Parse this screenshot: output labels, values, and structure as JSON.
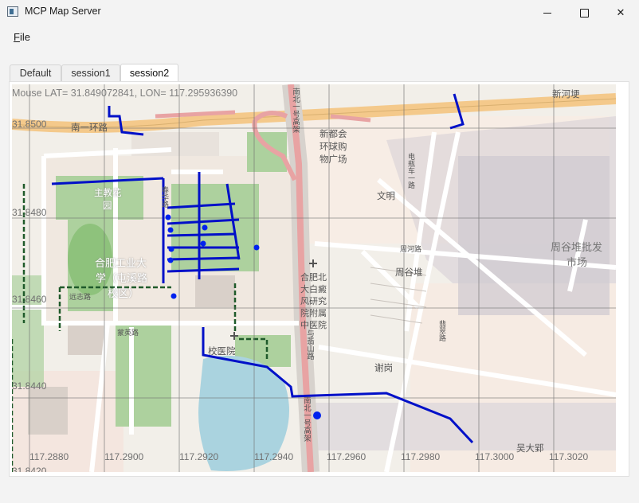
{
  "window": {
    "title": "MCP Map Server",
    "minimize_glyph": "—",
    "close_glyph": "✕"
  },
  "menu": {
    "file_label": "File"
  },
  "tabs": [
    {
      "label": "Default",
      "active": false
    },
    {
      "label": "session1",
      "active": false
    },
    {
      "label": "session2",
      "active": true
    }
  ],
  "map": {
    "mouse_readout": "Mouse LAT=  31.849072841, LON=  117.295936390",
    "lat_labels": [
      "31.8500",
      "31.8480",
      "31.8460",
      "31.8440",
      "31.8420"
    ],
    "lon_labels": [
      "117.2880",
      "117.2900",
      "117.2920",
      "117.2940",
      "117.2960",
      "117.2980",
      "117.3000",
      "117.3020"
    ],
    "places": {
      "nanyihuan": "南一环路",
      "xinhegeng": "新河埂",
      "xinduhui": "新都会",
      "huanqiu": "环球购",
      "wuguangchang": "物广场",
      "wenming": "文明",
      "zhoudui": "周谷堆",
      "zhougu_market_1": "周谷堆批发",
      "zhougu_market_2": "市场",
      "zhujiaohua_1": "主教花",
      "zhujiaohua_2": "园",
      "hfut_1": "合肥工业大",
      "hfut_2": "学（屯溪路",
      "hfut_3": "校区）",
      "yuanzhilu": "远志路",
      "mengyinglu": "蒙英路",
      "xiaoyiyuan": "校医院",
      "hospital_1": "合肥北",
      "hospital_2": "大白癜",
      "hospital_3": "风研究",
      "hospital_4": "院附属",
      "hospital_5": "中医院",
      "xiegang": "谢岗",
      "wudaying": "吴大郢",
      "nanbei_road": "南北一号高架",
      "nanbei_road2": "南北一号高架",
      "yumeishan": "与翡山路",
      "zhouhe": "周河路",
      "hewanglu": "翡翠路",
      "chunhua": "春华路",
      "zhongdian": "电瓶车一路"
    },
    "colors": {
      "route": "#0010c8",
      "marker": "#0022ee",
      "highway": "#e8a3a3",
      "trunk": "#f4c98b",
      "water": "#aad3df",
      "park": "#add19e",
      "landuse": "#d9d0c9"
    }
  }
}
